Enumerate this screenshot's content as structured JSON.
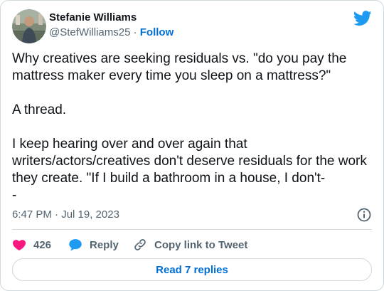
{
  "author": {
    "name": "Stefanie Williams",
    "handle": "@StefWilliams25",
    "separator": "·",
    "follow_label": "Follow"
  },
  "tweet": {
    "text": "Why creatives are seeking residuals vs. \"do you pay the mattress maker every time you sleep on a mattress?\"\n\nA thread.\n\nI keep hearing over and over again that writers/actors/creatives don't deserve residuals for the work they create. \"If I build a bathroom in a house, I don't-\n-",
    "timestamp": "6:47 PM · Jul 19, 2023"
  },
  "actions": {
    "like_count": "426",
    "reply_label": "Reply",
    "copy_label": "Copy link to Tweet"
  },
  "footer": {
    "read_replies_label": "Read 7 replies"
  },
  "colors": {
    "brand": "#1d9bf0",
    "like": "#f91880",
    "link": "#006fd6",
    "muted": "#536471",
    "border": "#cfd9de"
  },
  "icons": {
    "logo": "twitter-bird-icon",
    "like": "heart-icon",
    "reply": "speech-bubble-icon",
    "copy": "link-icon",
    "info": "info-icon"
  }
}
